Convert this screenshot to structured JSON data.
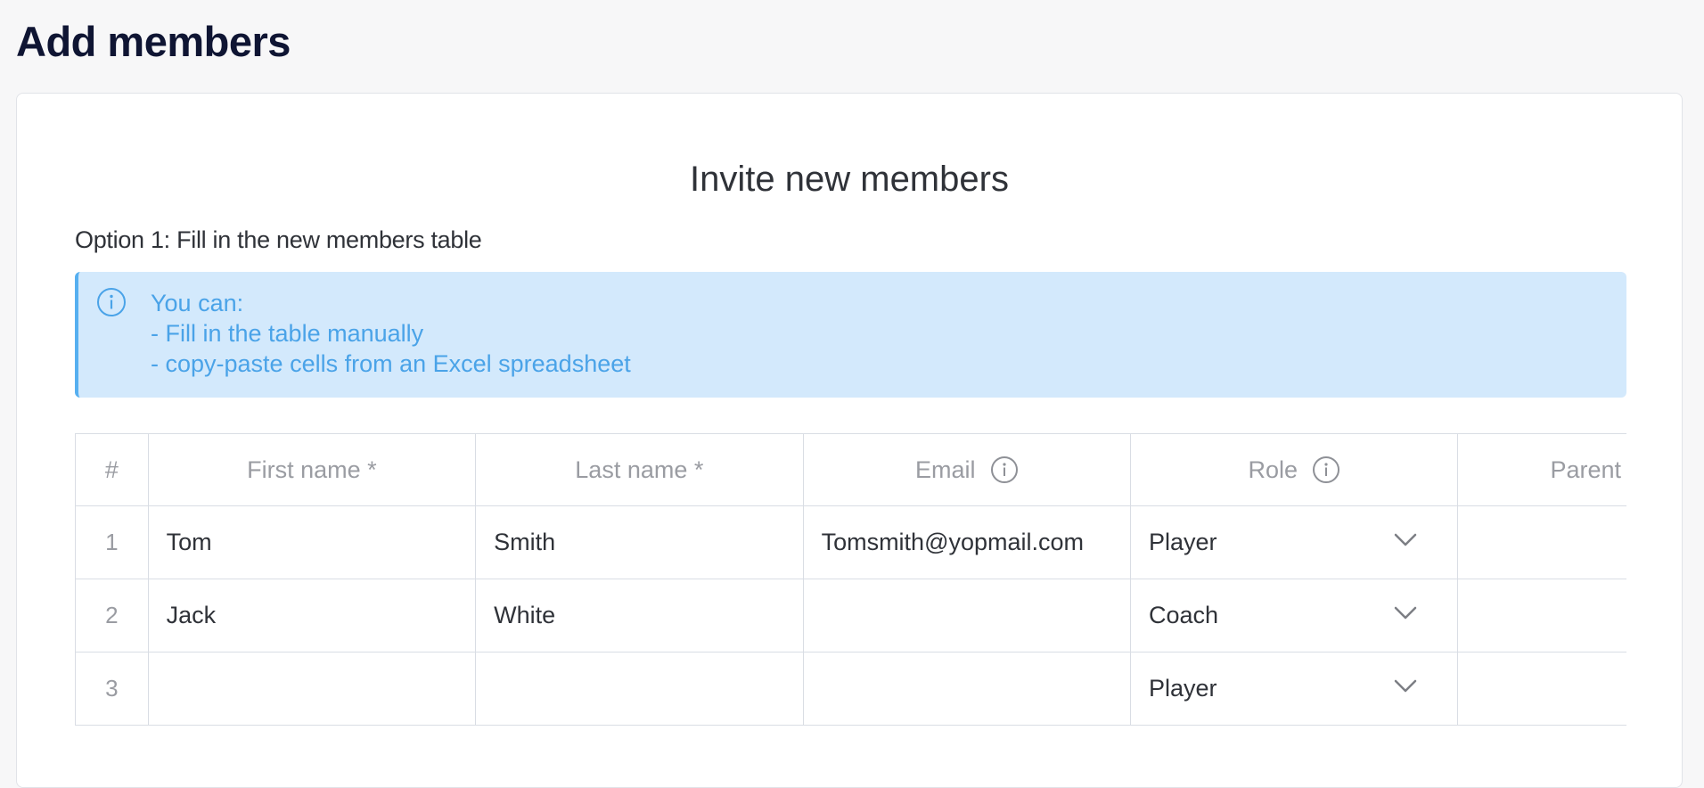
{
  "page": {
    "title": "Add members"
  },
  "card": {
    "section_title": "Invite new members",
    "option_title": "Option 1: Fill in the new members table",
    "info": {
      "icon": "info-icon",
      "lines": [
        "You can:",
        "- Fill in the table manually",
        "- copy-paste cells from an Excel spreadsheet"
      ]
    }
  },
  "table": {
    "headers": {
      "num": "#",
      "first_name": "First name *",
      "last_name": "Last name *",
      "email": "Email",
      "role": "Role",
      "parent_email": "Parent e-mail"
    },
    "rows": [
      {
        "num": "1",
        "first_name": "Tom",
        "last_name": "Smith",
        "email": "Tomsmith@yopmail.com",
        "role": "Player",
        "parent_email": ""
      },
      {
        "num": "2",
        "first_name": "Jack",
        "last_name": "White",
        "email": "",
        "role": "Coach",
        "parent_email": ""
      },
      {
        "num": "3",
        "first_name": "",
        "last_name": "",
        "email": "",
        "role": "Player",
        "parent_email": ""
      }
    ]
  },
  "colors": {
    "info_bg": "#d3e9fc",
    "info_accent": "#56aff0",
    "info_text": "#4aa3e8",
    "title_text": "#0f1533"
  }
}
